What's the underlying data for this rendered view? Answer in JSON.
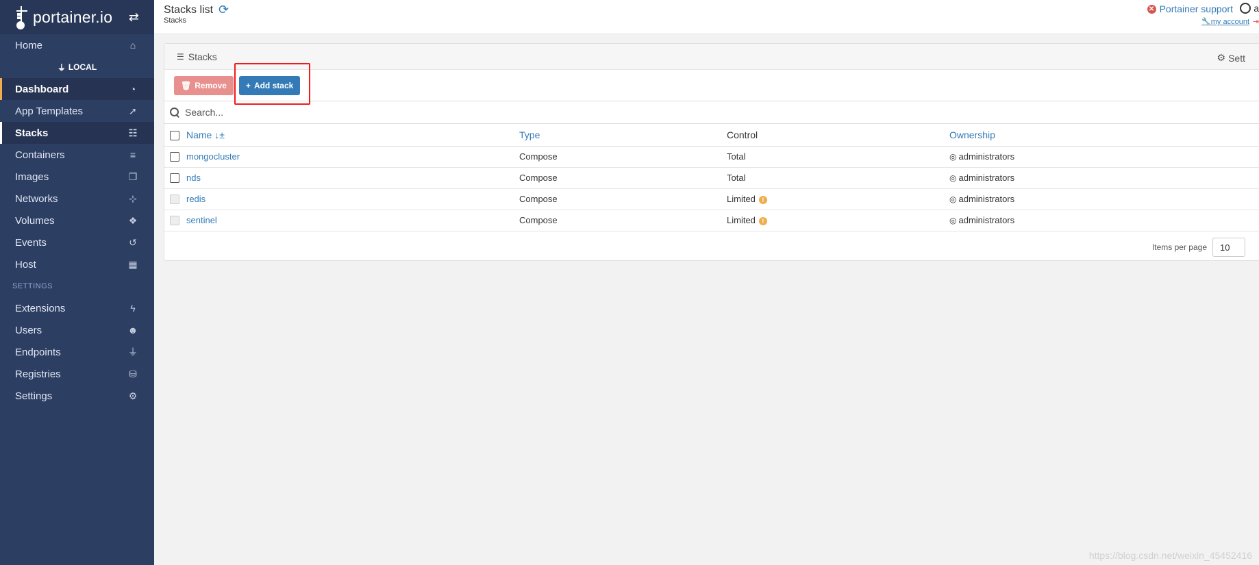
{
  "sidebar": {
    "logo_text": "portainer.io",
    "switch_icon": "exchange-icon",
    "home": "Home",
    "endpoint": "LOCAL",
    "items": [
      {
        "label": "Dashboard",
        "icon": "dashboard-icon"
      },
      {
        "label": "App Templates",
        "icon": "rocket-icon"
      },
      {
        "label": "Stacks",
        "icon": "th-list-icon"
      },
      {
        "label": "Containers",
        "icon": "server-icon"
      },
      {
        "label": "Images",
        "icon": "clone-icon"
      },
      {
        "label": "Networks",
        "icon": "sitemap-icon"
      },
      {
        "label": "Volumes",
        "icon": "cubes-icon"
      },
      {
        "label": "Events",
        "icon": "history-icon"
      },
      {
        "label": "Host",
        "icon": "th-icon"
      }
    ],
    "settings_title": "SETTINGS",
    "settings_items": [
      {
        "label": "Extensions",
        "icon": "bolt-icon"
      },
      {
        "label": "Users",
        "icon": "users-icon"
      },
      {
        "label": "Endpoints",
        "icon": "plug-icon"
      },
      {
        "label": "Registries",
        "icon": "database-icon"
      },
      {
        "label": "Settings",
        "icon": "cogs-icon"
      }
    ]
  },
  "header": {
    "title": "Stacks list",
    "breadcrumb": "Stacks",
    "support": "Portainer support",
    "account": "my account",
    "user": "a"
  },
  "widget": {
    "title": "Stacks",
    "settings": "Sett",
    "remove_label": "Remove",
    "add_label": "Add stack",
    "search_placeholder": "Search...",
    "columns": {
      "name": "Name",
      "type": "Type",
      "control": "Control",
      "ownership": "Ownership"
    },
    "rows": [
      {
        "name": "mongocluster",
        "type": "Compose",
        "control": "Total",
        "ownership": "administrators",
        "selectable": true
      },
      {
        "name": "nds",
        "type": "Compose",
        "control": "Total",
        "ownership": "administrators",
        "selectable": true
      },
      {
        "name": "redis",
        "type": "Compose",
        "control": "Limited",
        "ownership": "administrators",
        "selectable": false
      },
      {
        "name": "sentinel",
        "type": "Compose",
        "control": "Limited",
        "ownership": "administrators",
        "selectable": false
      }
    ],
    "items_per_page_label": "Items per page",
    "items_per_page": "10"
  },
  "watermark": "https://blog.csdn.net/weixin_45452416",
  "colors": {
    "sidebar": "#2d3e63",
    "accent": "#337ab7",
    "danger": "#d9534f",
    "highlight": "#ee1c1c"
  }
}
